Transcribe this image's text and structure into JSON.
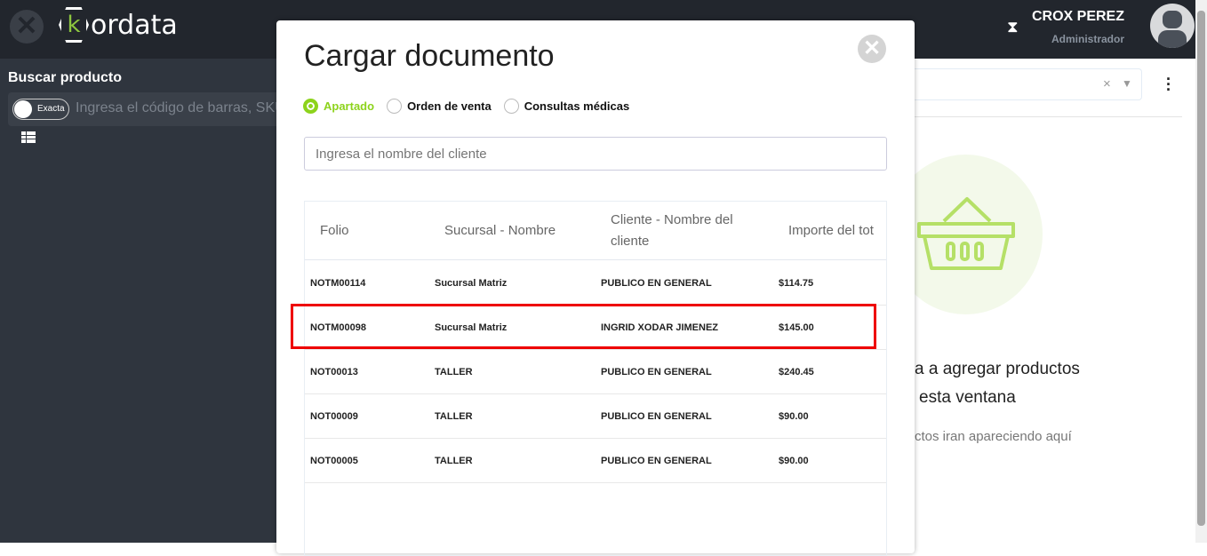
{
  "header": {
    "brand": "kordata",
    "brand_letter": "k",
    "user_name": "CROX PEREZ",
    "user_role": "Administrador"
  },
  "left": {
    "title": "Buscar producto",
    "toggle_label": "Exacta",
    "search_placeholder": "Ingresa el código de barras, SKU"
  },
  "right": {
    "text1": "a a agregar productos",
    "text2": "esta ventana",
    "text3": "ctos iran apareciendo aquí",
    "clear": "×"
  },
  "modal": {
    "title": "Cargar documento",
    "radios": [
      {
        "label": "Apartado",
        "selected": true
      },
      {
        "label": "Orden de venta",
        "selected": false
      },
      {
        "label": "Consultas médicas",
        "selected": false
      }
    ],
    "client_placeholder": "Ingresa el nombre del cliente",
    "columns": [
      "Folio",
      "Sucursal - Nombre",
      "Cliente - Nombre del cliente",
      "Importe del tot"
    ],
    "rows": [
      [
        "NOTM00114",
        "Sucursal Matriz",
        "PUBLICO EN GENERAL",
        "$114.75"
      ],
      [
        "NOTM00098",
        "Sucursal Matriz",
        "INGRID XODAR JIMENEZ",
        "$145.00"
      ],
      [
        "NOT00013",
        "TALLER",
        "PUBLICO EN GENERAL",
        "$240.45"
      ],
      [
        "NOT00009",
        "TALLER",
        "PUBLICO EN GENERAL",
        "$90.00"
      ],
      [
        "NOT00005",
        "TALLER",
        "PUBLICO EN GENERAL",
        "$90.00"
      ]
    ],
    "highlighted_row": 1
  },
  "colors": {
    "accent": "#8dd31c",
    "header_bg": "#22262d",
    "highlight": "#e00000"
  }
}
